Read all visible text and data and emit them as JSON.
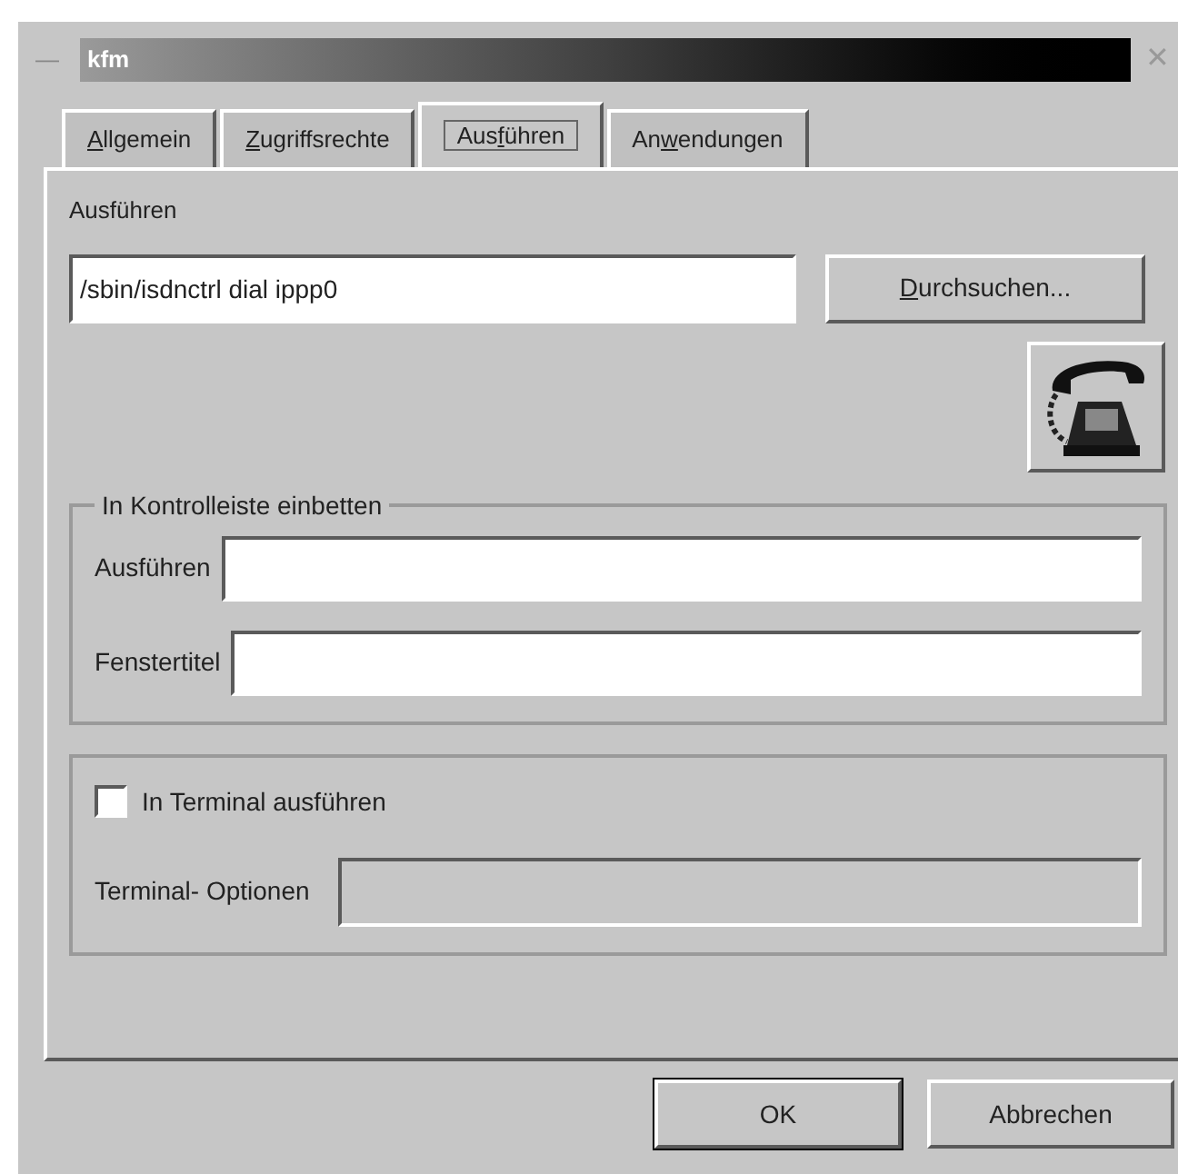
{
  "window": {
    "title": "kfm",
    "menu_glyph": "—",
    "close_glyph": "✕"
  },
  "tabs": [
    {
      "key": "A",
      "after": "llgemein",
      "selected": false
    },
    {
      "key": "Z",
      "after": "ugriffsrechte",
      "selected": false
    },
    {
      "before": "Aus",
      "key": "f",
      "after": "ühren",
      "selected": true
    },
    {
      "before": "An",
      "key": "w",
      "after": "endungen",
      "selected": false
    }
  ],
  "execute": {
    "heading": "Ausführen",
    "value": "/sbin/isdnctrl dial ippp0",
    "browse": {
      "key": "D",
      "after": "urchsuchen..."
    }
  },
  "panel_embed": {
    "legend": "In Kontrolleiste einbetten",
    "fields": [
      {
        "label": "Ausführen"
      },
      {
        "label": "Fenstertitel"
      }
    ]
  },
  "terminal": {
    "checkbox": {
      "label": "In Terminal ausführen",
      "checked": false
    },
    "options": {
      "label": "Terminal- Optionen",
      "disabled": true
    }
  },
  "buttons": [
    {
      "label": "OK",
      "default": true
    },
    {
      "label": "Abbrechen",
      "default": false
    }
  ]
}
